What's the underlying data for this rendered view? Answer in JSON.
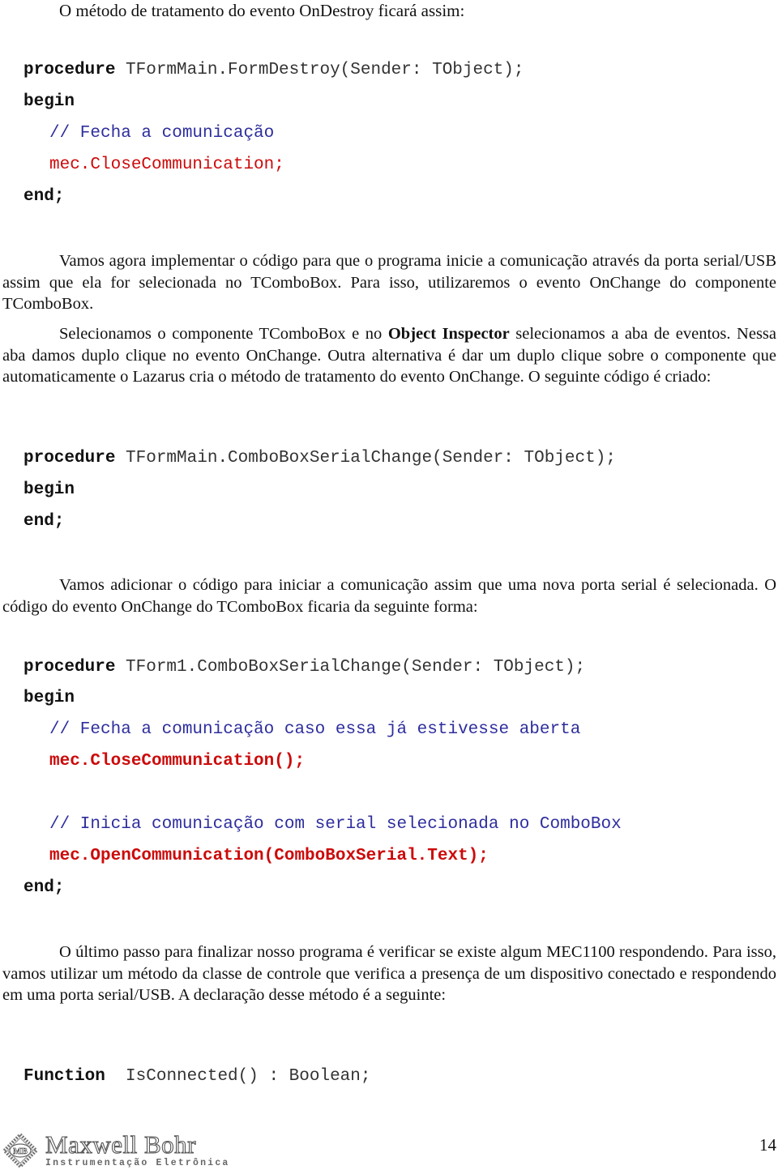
{
  "intro": "O método de tratamento do evento OnDestroy ficará assim:",
  "code1": {
    "line1_kw": "procedure",
    "line1_rest": " TFormMain.FormDestroy(Sender: TObject);",
    "begin": "begin",
    "comment": "// Fecha a comunicação",
    "call": "mec.CloseCommunication;",
    "end": "end;"
  },
  "para1": "Vamos agora implementar o código para que o programa inicie a comunicação através da porta serial/USB assim que ela for selecionada no TComboBox. Para isso, utilizaremos o evento OnChange do componente TComboBox.",
  "para2": {
    "before": "Selecionamos o componente TComboBox e no ",
    "bold": "Object Inspector",
    "after": " selecionamos a aba de eventos. Nessa aba damos duplo clique no evento OnChange. Outra alternativa é dar um duplo clique sobre o componente que automaticamente o Lazarus cria o método de tratamento do evento OnChange. O seguinte código é criado:"
  },
  "code2": {
    "line1_kw": "procedure",
    "line1_rest": " TFormMain.ComboBoxSerialChange(Sender: TObject);",
    "begin": "begin",
    "end": "end;"
  },
  "para3": "Vamos adicionar o código para iniciar a comunicação assim que uma nova porta serial é selecionada. O código do evento OnChange do TComboBox ficaria da seguinte forma:",
  "code3": {
    "line1_kw": "procedure",
    "line1_rest": " TForm1.ComboBoxSerialChange(Sender: TObject);",
    "begin": "begin",
    "comment1": "// Fecha a comunicação caso essa já estivesse aberta",
    "call1": "mec.CloseCommunication();",
    "comment2": "// Inicia comunicação com serial selecionada no ComboBox",
    "call2": "mec.OpenCommunication(ComboBoxSerial.Text);",
    "end": "end;"
  },
  "para4": "O último passo para finalizar nosso programa é verificar se existe algum MEC1100 respondendo. Para isso, vamos utilizar um método da classe de controle que verifica a presença de um dispositivo conectado e respondendo em uma porta serial/USB. A declaração desse método é a seguinte:",
  "code4": {
    "kw": "Function",
    "rest": "  IsConnected() : Boolean;"
  },
  "footer": {
    "logo_monogram": "MB",
    "brand_name": "Maxwell Bohr",
    "brand_tagline": "Instrumentação Eletrônica",
    "page_number": "14"
  },
  "colors": {
    "comment": "#2e2e9e",
    "call": "#cc0a0a",
    "text": "#111111"
  }
}
